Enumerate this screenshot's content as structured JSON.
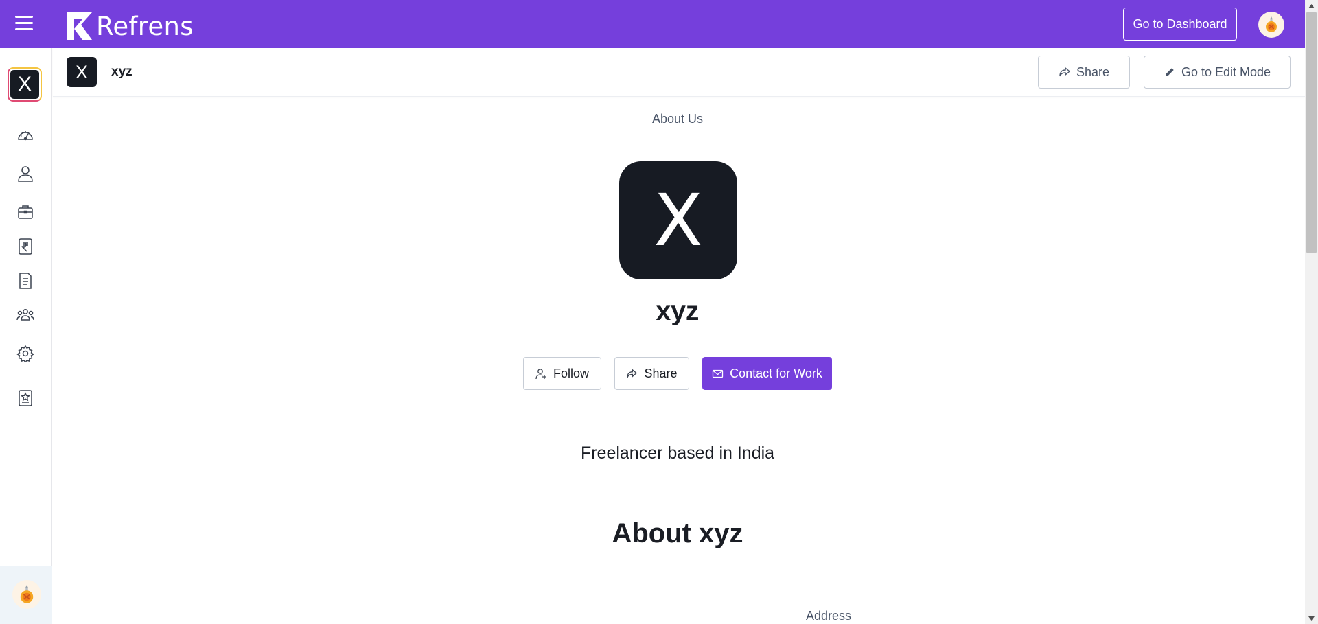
{
  "header": {
    "brand": "Refrens",
    "dashboard_label": "Go to Dashboard",
    "avatar_icon": "user-avatar-icon",
    "brand_color": "#753fdc"
  },
  "sidebar": {
    "business_initial": "X",
    "items": [
      {
        "name": "dashboard",
        "icon": "speedometer-icon"
      },
      {
        "name": "profile",
        "icon": "user-icon"
      },
      {
        "name": "portfolio",
        "icon": "briefcase-icon"
      },
      {
        "name": "accounting",
        "icon": "rupee-icon"
      },
      {
        "name": "documents",
        "icon": "document-icon"
      },
      {
        "name": "team",
        "icon": "users-icon"
      },
      {
        "name": "settings",
        "icon": "gear-icon"
      },
      {
        "name": "reviews",
        "icon": "star-badge-icon"
      }
    ]
  },
  "subheader": {
    "business_initial": "X",
    "business_name": "xyz",
    "share_label": "Share",
    "edit_label": "Go to Edit Mode"
  },
  "main": {
    "about_tab": "About Us",
    "logo_initial": "X",
    "name": "xyz",
    "follow_label": "Follow",
    "share_label": "Share",
    "contact_label": "Contact for Work",
    "tagline": "Freelancer based in India",
    "about_heading": "About xyz",
    "address_label": "Address"
  }
}
